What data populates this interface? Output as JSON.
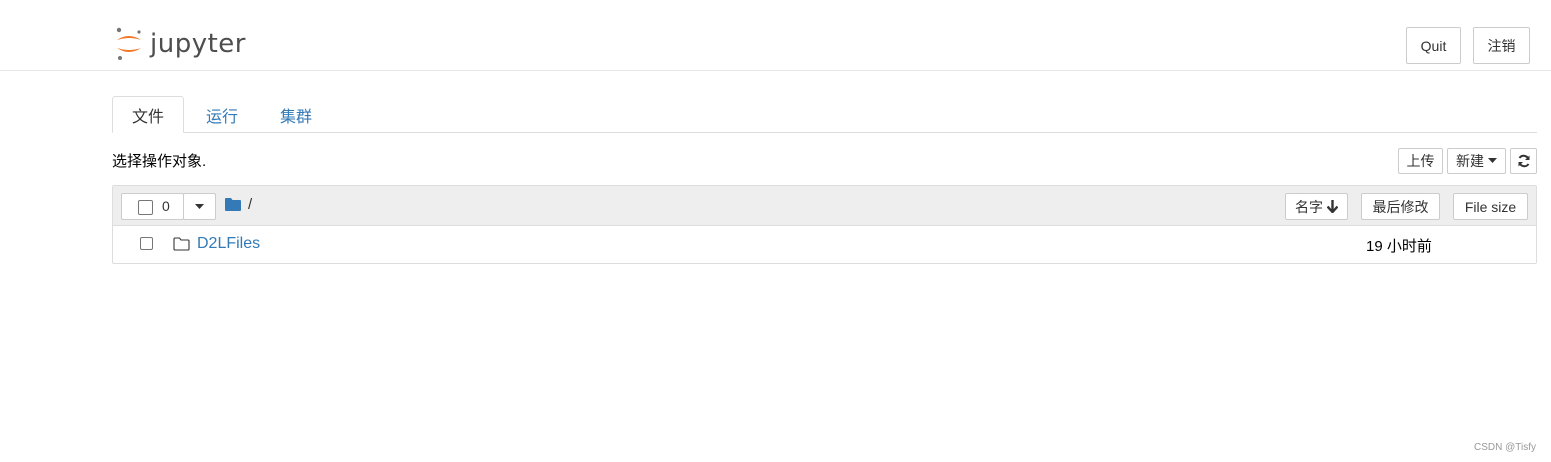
{
  "header": {
    "logo_text": "jupyter",
    "quit_label": "Quit",
    "logout_label": "注销"
  },
  "tabs": [
    {
      "label": "文件",
      "active": true
    },
    {
      "label": "运行",
      "active": false
    },
    {
      "label": "集群",
      "active": false
    }
  ],
  "toolbar": {
    "prompt": "选择操作对象.",
    "upload_label": "上传",
    "new_label": "新建",
    "refresh_icon": "refresh-icon"
  },
  "list_header": {
    "selected_count": "0",
    "breadcrumb": "/",
    "sort_name_label": "名字",
    "sort_modified_label": "最后修改",
    "sort_size_label": "File size"
  },
  "items": [
    {
      "name": "D2LFiles",
      "type": "folder",
      "modified": "19 小时前"
    }
  ],
  "footer": {
    "watermark": "CSDN @Tisfy"
  },
  "colors": {
    "link": "#337ab7",
    "logo_orange": "#f37726",
    "logo_gray": "#767677"
  }
}
